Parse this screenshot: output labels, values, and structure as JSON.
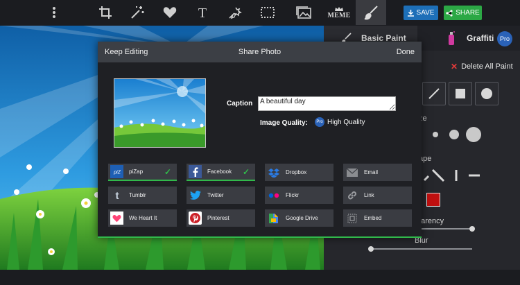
{
  "toolbar": {
    "tools": [
      {
        "name": "more-icon"
      },
      {
        "name": "crop-icon"
      },
      {
        "name": "magic-wand-icon"
      },
      {
        "name": "heart-icon"
      },
      {
        "name": "text-icon"
      },
      {
        "name": "sticker-icon"
      },
      {
        "name": "frame-icon"
      },
      {
        "name": "photos-icon"
      },
      {
        "name": "meme-icon",
        "label": "MEME"
      },
      {
        "name": "paintbrush-icon"
      }
    ],
    "save_label": "SAVE",
    "share_label": "SHARE",
    "colors": {
      "save": "#1d6fb8",
      "share": "#2ca845",
      "accent_green": "#31b94b"
    }
  },
  "right_panel": {
    "tab_basic": "Basic Paint",
    "tab_graffiti": "Graffiti",
    "pro_badge": "Pro",
    "delete_all": "Delete All Paint",
    "size_label_fragment": "ze",
    "shape_label_fragment": "ape",
    "transparency_fragment": "parency",
    "blur_label": "Blur",
    "brush_color": "#c01010"
  },
  "modal": {
    "keep_editing": "Keep Editing",
    "title": "Share Photo",
    "done": "Done",
    "caption_label": "Caption",
    "caption_value": "A beautiful day",
    "quality_label": "Image Quality:",
    "quality_badge": "Pro",
    "quality_value": "High Quality",
    "share_targets": [
      {
        "id": "pizap",
        "label": "piZap",
        "icon": "pizap-logo-icon",
        "checked": true
      },
      {
        "id": "facebook",
        "label": "Facebook",
        "icon": "facebook-icon",
        "checked": true
      },
      {
        "id": "dropbox",
        "label": "Dropbox",
        "icon": "dropbox-icon",
        "checked": false
      },
      {
        "id": "email",
        "label": "Email",
        "icon": "email-icon",
        "checked": false
      },
      {
        "id": "tumblr",
        "label": "Tumblr",
        "icon": "tumblr-icon",
        "checked": false
      },
      {
        "id": "twitter",
        "label": "Twitter",
        "icon": "twitter-icon",
        "checked": false
      },
      {
        "id": "flickr",
        "label": "Flickr",
        "icon": "flickr-icon",
        "checked": false
      },
      {
        "id": "link",
        "label": "Link",
        "icon": "link-icon",
        "checked": false
      },
      {
        "id": "weheartit",
        "label": "We Heart It",
        "icon": "we-heart-it-icon",
        "checked": false
      },
      {
        "id": "pinterest",
        "label": "Pinterest",
        "icon": "pinterest-icon",
        "checked": false
      },
      {
        "id": "googledrive",
        "label": "Google Drive",
        "icon": "google-drive-icon",
        "checked": false
      },
      {
        "id": "embed",
        "label": "Embed",
        "icon": "embed-icon",
        "checked": false
      }
    ]
  }
}
